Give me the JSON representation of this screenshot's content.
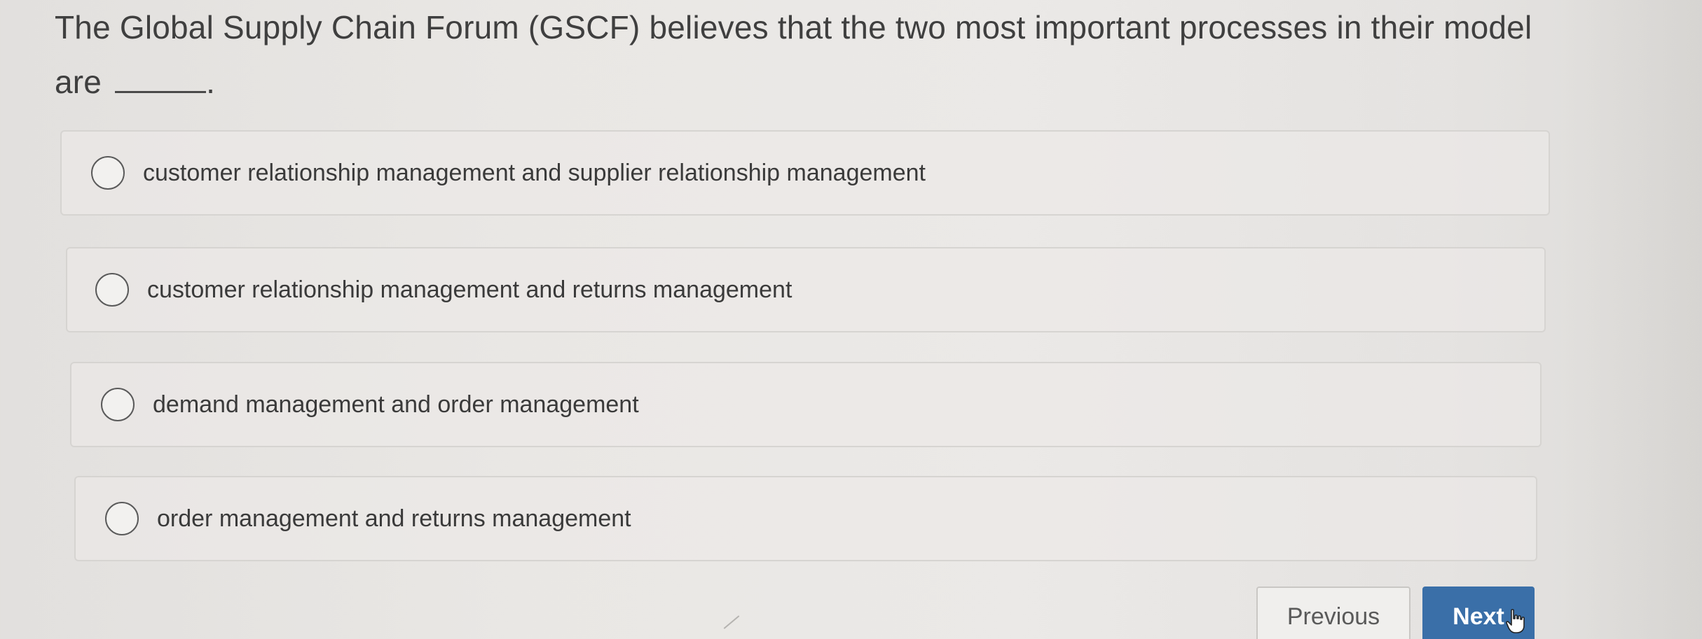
{
  "question": {
    "text_before_blank": "The Global Supply Chain Forum (GSCF) believes that the two most important processes in their model are",
    "text_after_blank": "."
  },
  "options": [
    {
      "label": "customer relationship management and supplier relationship management",
      "selected": false
    },
    {
      "label": "customer relationship management and returns management",
      "selected": false
    },
    {
      "label": "demand management and order management",
      "selected": false
    },
    {
      "label": "order management and returns management",
      "selected": false
    }
  ],
  "navigation": {
    "previous_label": "Previous",
    "next_label": "Next"
  },
  "colors": {
    "next_button": "#3a6fa8",
    "border": "#d6d4d1",
    "text": "#3a3a3a"
  },
  "icons": {
    "option_selector": "radio-circle",
    "pointer": "hand-pointer-icon"
  }
}
